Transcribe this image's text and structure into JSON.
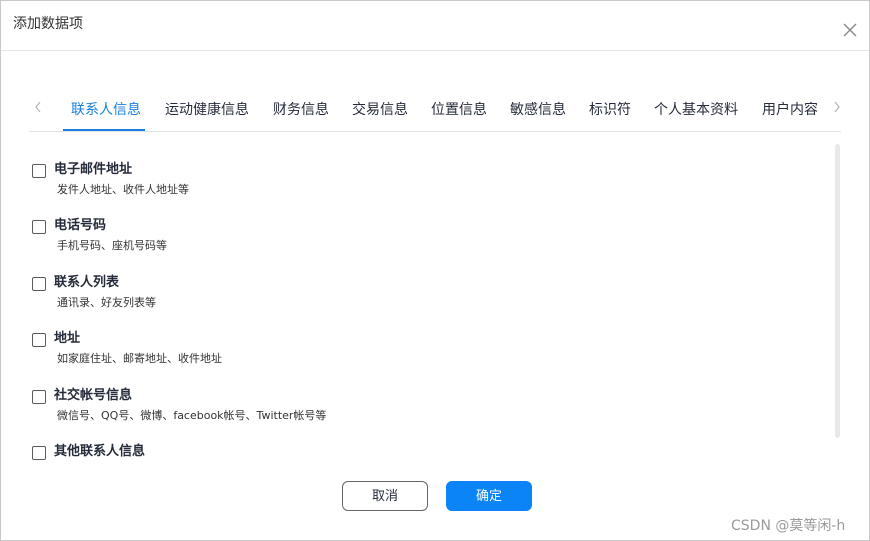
{
  "dialog": {
    "title": "添加数据项"
  },
  "tabs": [
    {
      "label": "联系人信息",
      "active": true
    },
    {
      "label": "运动健康信息",
      "active": false
    },
    {
      "label": "财务信息",
      "active": false
    },
    {
      "label": "交易信息",
      "active": false
    },
    {
      "label": "位置信息",
      "active": false
    },
    {
      "label": "敏感信息",
      "active": false
    },
    {
      "label": "标识符",
      "active": false
    },
    {
      "label": "个人基本资料",
      "active": false
    },
    {
      "label": "用户内容",
      "active": false
    }
  ],
  "items": [
    {
      "title": "电子邮件地址",
      "desc": "发件人地址、收件人地址等",
      "checked": false
    },
    {
      "title": "电话号码",
      "desc": "手机号码、座机号码等",
      "checked": false
    },
    {
      "title": "联系人列表",
      "desc": "通讯录、好友列表等",
      "checked": false
    },
    {
      "title": "地址",
      "desc": "如家庭住址、邮寄地址、收件地址",
      "checked": false
    },
    {
      "title": "社交帐号信息",
      "desc": "微信号、QQ号、微博、facebook帐号、Twitter帐号等",
      "checked": false
    },
    {
      "title": "其他联系人信息",
      "desc": "",
      "checked": false
    }
  ],
  "buttons": {
    "cancel": "取消",
    "ok": "确定"
  },
  "watermark": "CSDN @莫等闲-h",
  "colors": {
    "accent": "#1a7fe0",
    "primary_button": "#0a84f6"
  }
}
